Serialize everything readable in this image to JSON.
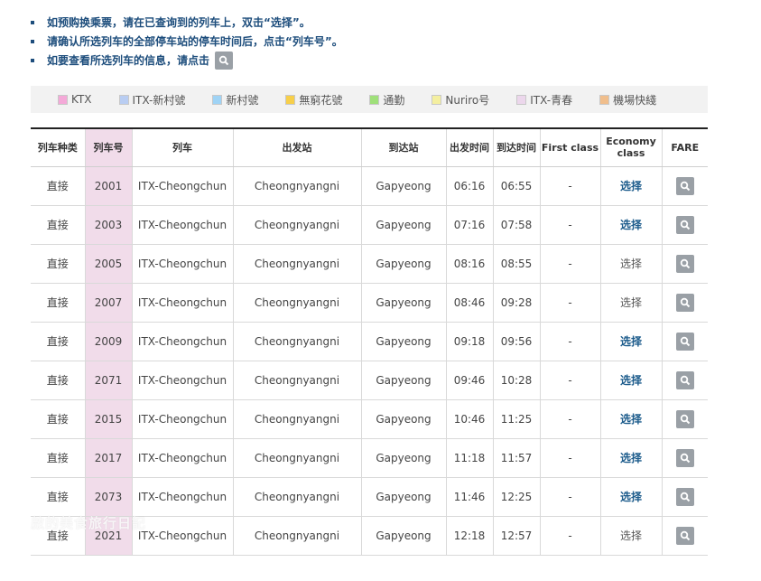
{
  "notes": [
    "如预购换乘票，请在已查询到的列车上，双击“选择”。",
    "请确认所选列车的全部停车站的停车时间后，点击“列车号”。",
    "如要查看所选列车的信息，请点击"
  ],
  "legend": [
    {
      "label": "KTX",
      "color": "#f4a9d8"
    },
    {
      "label": "ITX-新村號",
      "color": "#b9cdf2"
    },
    {
      "label": "新村號",
      "color": "#9fd3f5"
    },
    {
      "label": "無窮花號",
      "color": "#f7cf4a"
    },
    {
      "label": "通勤",
      "color": "#9fe07a"
    },
    {
      "label": "Nuriro号",
      "color": "#f4efa0"
    },
    {
      "label": "ITX-青春",
      "color": "#ecd7ec"
    },
    {
      "label": "機場快綫",
      "color": "#f0be8c"
    }
  ],
  "table": {
    "headers": {
      "type": "列车种类",
      "train_no": "列车号",
      "train": "列车",
      "departure_station": "出发站",
      "arrival_station": "到达站",
      "departure_time": "出发时间",
      "arrival_time": "到达时间",
      "first_class": "First class",
      "economy_class": "Economy class",
      "fare": "FARE"
    },
    "rows": [
      {
        "type": "直接",
        "train_no": "2001",
        "train": "ITX-Cheongchun",
        "dep": "Cheongnyangni",
        "arr": "Gapyeong",
        "dep_time": "06:16",
        "arr_time": "06:55",
        "first": "-",
        "economy": "选择",
        "economy_link": true
      },
      {
        "type": "直接",
        "train_no": "2003",
        "train": "ITX-Cheongchun",
        "dep": "Cheongnyangni",
        "arr": "Gapyeong",
        "dep_time": "07:16",
        "arr_time": "07:58",
        "first": "-",
        "economy": "选择",
        "economy_link": true
      },
      {
        "type": "直接",
        "train_no": "2005",
        "train": "ITX-Cheongchun",
        "dep": "Cheongnyangni",
        "arr": "Gapyeong",
        "dep_time": "08:16",
        "arr_time": "08:55",
        "first": "-",
        "economy": "选择",
        "economy_link": false
      },
      {
        "type": "直接",
        "train_no": "2007",
        "train": "ITX-Cheongchun",
        "dep": "Cheongnyangni",
        "arr": "Gapyeong",
        "dep_time": "08:46",
        "arr_time": "09:28",
        "first": "-",
        "economy": "选择",
        "economy_link": false
      },
      {
        "type": "直接",
        "train_no": "2009",
        "train": "ITX-Cheongchun",
        "dep": "Cheongnyangni",
        "arr": "Gapyeong",
        "dep_time": "09:18",
        "arr_time": "09:56",
        "first": "-",
        "economy": "选择",
        "economy_link": true
      },
      {
        "type": "直接",
        "train_no": "2071",
        "train": "ITX-Cheongchun",
        "dep": "Cheongnyangni",
        "arr": "Gapyeong",
        "dep_time": "09:46",
        "arr_time": "10:28",
        "first": "-",
        "economy": "选择",
        "economy_link": true
      },
      {
        "type": "直接",
        "train_no": "2015",
        "train": "ITX-Cheongchun",
        "dep": "Cheongnyangni",
        "arr": "Gapyeong",
        "dep_time": "10:46",
        "arr_time": "11:25",
        "first": "-",
        "economy": "选择",
        "economy_link": true
      },
      {
        "type": "直接",
        "train_no": "2017",
        "train": "ITX-Cheongchun",
        "dep": "Cheongnyangni",
        "arr": "Gapyeong",
        "dep_time": "11:18",
        "arr_time": "11:57",
        "first": "-",
        "economy": "选择",
        "economy_link": true
      },
      {
        "type": "直接",
        "train_no": "2073",
        "train": "ITX-Cheongchun",
        "dep": "Cheongnyangni",
        "arr": "Gapyeong",
        "dep_time": "11:46",
        "arr_time": "12:25",
        "first": "-",
        "economy": "选择",
        "economy_link": true
      },
      {
        "type": "直接",
        "train_no": "2021",
        "train": "ITX-Cheongchun",
        "dep": "Cheongnyangni",
        "arr": "Gapyeong",
        "dep_time": "12:18",
        "arr_time": "12:57",
        "first": "-",
        "economy": "选择",
        "economy_link": false
      }
    ]
  },
  "watermark": "啟的美食旅行日記"
}
